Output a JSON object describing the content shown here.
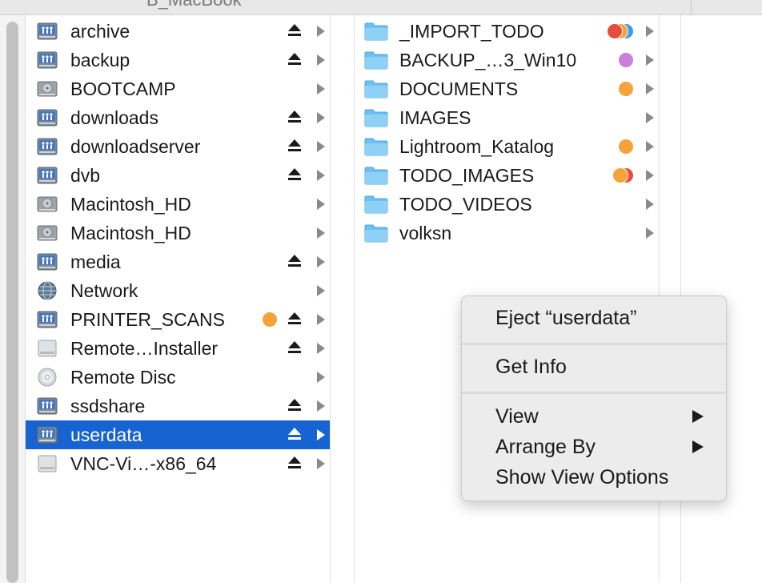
{
  "window": {
    "title": "B_MacBook"
  },
  "volumes": [
    {
      "label": "archive",
      "icon": "network-share-icon",
      "eject": true
    },
    {
      "label": "backup",
      "icon": "network-share-icon",
      "eject": true
    },
    {
      "label": "BOOTCAMP",
      "icon": "hard-drive-icon",
      "eject": false
    },
    {
      "label": "downloads",
      "icon": "network-share-icon",
      "eject": true
    },
    {
      "label": "downloadserver",
      "icon": "network-share-icon",
      "eject": true
    },
    {
      "label": "dvb",
      "icon": "network-share-icon",
      "eject": true
    },
    {
      "label": "Macintosh_HD",
      "icon": "hard-drive-icon",
      "eject": false
    },
    {
      "label": "Macintosh_HD",
      "icon": "hard-drive-icon",
      "eject": false
    },
    {
      "label": "media",
      "icon": "network-share-icon",
      "eject": true
    },
    {
      "label": "Network",
      "icon": "network-globe-icon",
      "eject": false
    },
    {
      "label": "PRINTER_SCANS",
      "icon": "network-share-icon",
      "eject": true,
      "tag": "#f5a33a"
    },
    {
      "label": "Remote…Installer",
      "icon": "external-drive-icon",
      "eject": true
    },
    {
      "label": "Remote Disc",
      "icon": "optical-disc-icon",
      "eject": false
    },
    {
      "label": "ssdshare",
      "icon": "network-share-icon",
      "eject": true
    },
    {
      "label": "userdata",
      "icon": "network-share-icon",
      "eject": true,
      "selected": true
    },
    {
      "label": "VNC-Vi…-x86_64",
      "icon": "external-drive-icon",
      "eject": true
    }
  ],
  "folders": [
    {
      "label": "_IMPORT_TODO",
      "tags": [
        "#e74c3c",
        "#f5a33a",
        "#3a9cf0"
      ]
    },
    {
      "label": "BACKUP_…3_Win10",
      "tags": [
        "#c97fdb"
      ]
    },
    {
      "label": "DOCUMENTS",
      "tags": [
        "#f5a33a"
      ]
    },
    {
      "label": "IMAGES",
      "tags": []
    },
    {
      "label": "Lightroom_Katalog",
      "tags": [
        "#f5a33a"
      ]
    },
    {
      "label": "TODO_IMAGES",
      "tags": [
        "#f5a33a",
        "#e74c3c"
      ]
    },
    {
      "label": "TODO_VIDEOS",
      "tags": []
    },
    {
      "label": "volksn",
      "tags": []
    }
  ],
  "context_menu": {
    "eject": "Eject “userdata”",
    "get_info": "Get Info",
    "view": "View",
    "arrange_by": "Arrange By",
    "show_view_options": "Show View Options"
  },
  "colors": {
    "selection": "#1763d2",
    "folder": "#6cc0f2",
    "menu_bg": "#ececec"
  }
}
